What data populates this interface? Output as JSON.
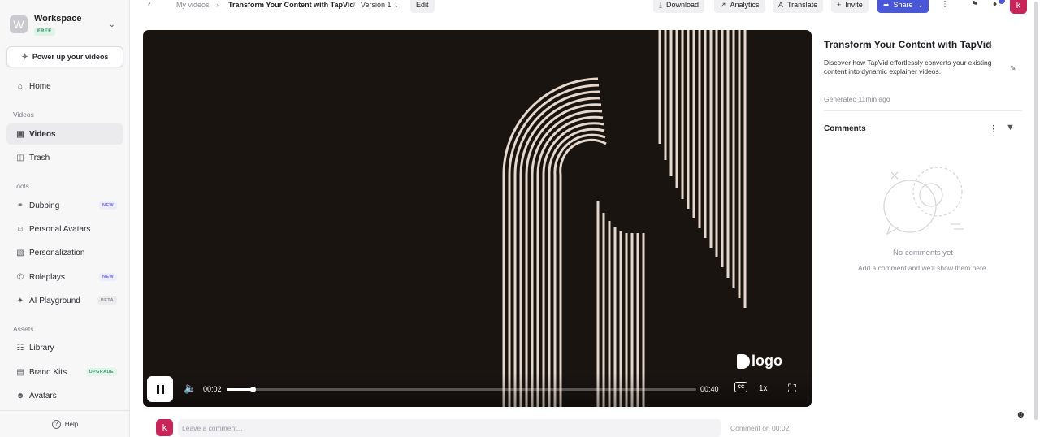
{
  "sidebar": {
    "workspace": {
      "initial": "W",
      "name": "Workspace",
      "plan": "FREE"
    },
    "power_up_label": "Power up your videos",
    "home_label": "Home",
    "sections": {
      "videos": "Videos",
      "tools": "Tools",
      "assets": "Assets"
    },
    "videos_items": [
      {
        "label": "Videos",
        "icon": "video-file-icon",
        "active": true
      },
      {
        "label": "Trash",
        "icon": "trash-icon"
      }
    ],
    "tools_items": [
      {
        "label": "Dubbing",
        "icon": "dubbing-icon",
        "tag": "NEW"
      },
      {
        "label": "Personal Avatars",
        "icon": "avatar-icon"
      },
      {
        "label": "Personalization",
        "icon": "personalization-icon"
      },
      {
        "label": "Roleplays",
        "icon": "roleplay-icon",
        "tag": "NEW"
      },
      {
        "label": "AI Playground",
        "icon": "sparkle-icon",
        "tag": "BETA"
      }
    ],
    "assets_items": [
      {
        "label": "Library",
        "icon": "book-icon"
      },
      {
        "label": "Brand Kits",
        "icon": "brand-icon",
        "tag": "UPGRADE"
      },
      {
        "label": "Avatars",
        "icon": "person-circle-icon"
      }
    ],
    "help_label": "Help"
  },
  "topbar": {
    "breadcrumb": {
      "root": "My videos",
      "current": "Transform Your Content with TapVid",
      "separator": "/",
      "version": "Version 1"
    },
    "edit_label": "Edit",
    "download_label": "Download",
    "analytics_label": "Analytics",
    "translate_label": "Translate",
    "invite_label": "Invite",
    "share_label": "Share",
    "user_initial": "k"
  },
  "player": {
    "logo_text": "logo",
    "current_time": "00:02",
    "duration": "00:40",
    "progress_fraction": 0.056,
    "cc_label": "CC",
    "speed": "1x"
  },
  "comment_bar": {
    "user_initial": "k",
    "placeholder": "Leave a comment...",
    "comment_on": "Comment on 00:02"
  },
  "panel": {
    "title": "Transform Your Content with TapVid",
    "description": "Discover how TapVid effortlessly converts your existing content into dynamic explainer videos.",
    "generated": "Generated 11min ago",
    "comments_label": "Comments",
    "empty_title": "No comments yet",
    "empty_subtitle": "Add a comment and we'll show them here."
  },
  "colors": {
    "accent": "#4a57d9",
    "avatar": "#c8245a",
    "video_bg": "#1a1411",
    "stripe": "#e6d8cc"
  }
}
